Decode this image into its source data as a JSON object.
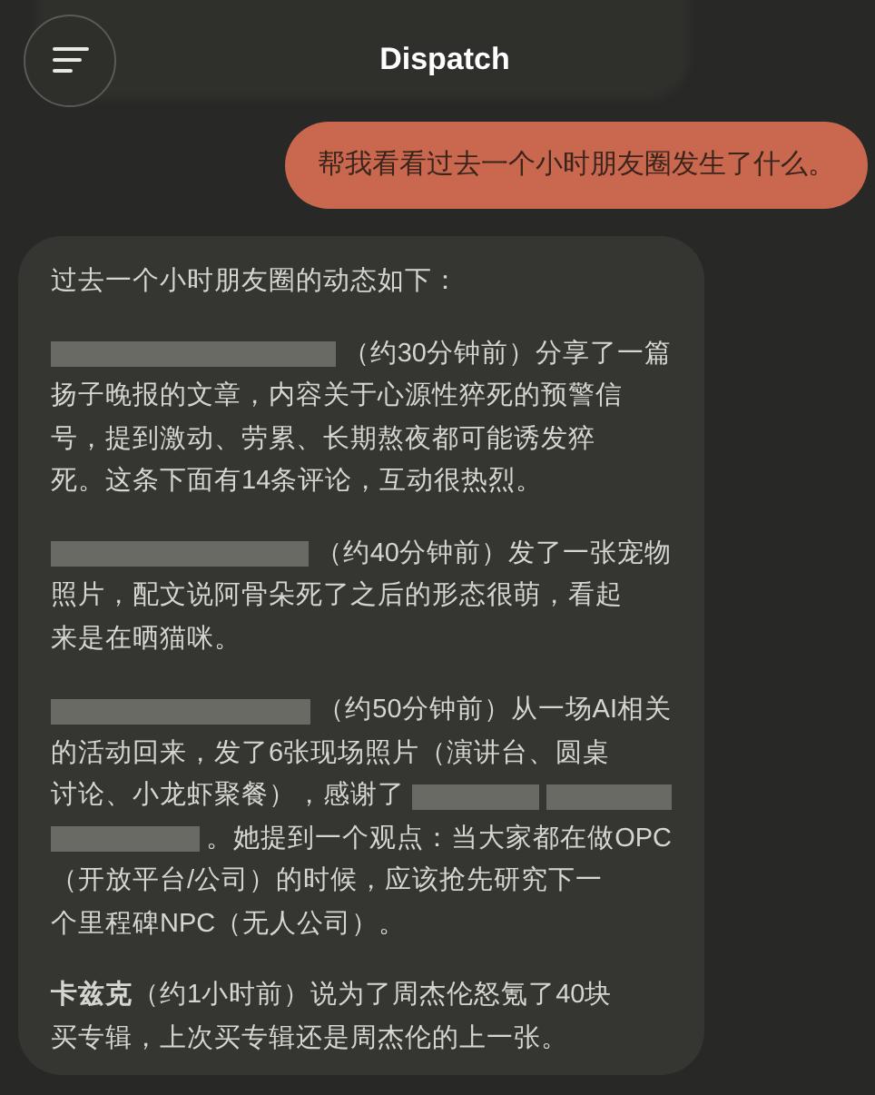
{
  "header": {
    "title": "Dispatch"
  },
  "user_message": {
    "text": "帮我看看过去一个小时朋友圈发生了什么。"
  },
  "reply": {
    "paragraphs": [
      [
        [
          {
            "kind": "text",
            "text": "过去一个小时朋友圈的动态如下："
          }
        ]
      ],
      [
        [
          {
            "kind": "redacted"
          },
          {
            "kind": "text",
            "text": "（约30分钟前）分享了一篇"
          }
        ],
        [
          {
            "kind": "text",
            "text": "扬子晚报的文章，内容关于心源性猝死的预警信"
          }
        ],
        [
          {
            "kind": "text",
            "text": "号，提到激动、劳累、长期熬夜都可能诱发猝"
          }
        ],
        [
          {
            "kind": "text",
            "text": "死。这条下面有14条评论，互动很热烈。"
          }
        ]
      ],
      [
        [
          {
            "kind": "redacted"
          },
          {
            "kind": "text",
            "text": "（约40分钟前）发了一张宠物"
          }
        ],
        [
          {
            "kind": "text",
            "text": "照片，配文说阿骨朵死了之后的形态很萌，看起"
          }
        ],
        [
          {
            "kind": "text",
            "text": "来是在晒猫咪。"
          }
        ]
      ],
      [
        [
          {
            "kind": "redacted"
          },
          {
            "kind": "text",
            "text": "（约50分钟前）从一场AI相关"
          }
        ],
        [
          {
            "kind": "text",
            "text": "的活动回来，发了6张现场照片（演讲台、圆桌"
          }
        ],
        [
          {
            "kind": "text",
            "text": "讨论、小龙虾聚餐），感谢了"
          },
          {
            "kind": "redacted"
          },
          {
            "kind": "redacted"
          }
        ],
        [
          {
            "kind": "redacted"
          },
          {
            "kind": "text",
            "text": "。她提到一个观点：当大家都在做OPC"
          }
        ],
        [
          {
            "kind": "text",
            "text": "（开放平台/公司）的时候，应该抢先研究下一"
          }
        ],
        [
          {
            "kind": "text",
            "text": "个里程碑NPC（无人公司）。"
          }
        ]
      ],
      [
        [
          {
            "kind": "text",
            "text": "**卡兹克**（约1小时前）说为了周杰伦怒氪了40块"
          }
        ],
        [
          {
            "kind": "text",
            "text": "买专辑，上次买专辑还是周杰伦的上一张。"
          }
        ]
      ]
    ]
  }
}
